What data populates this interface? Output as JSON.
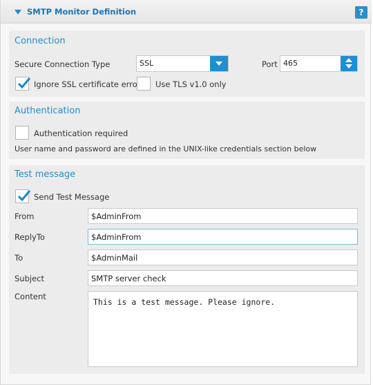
{
  "header": {
    "title": "SMTP Monitor Definition",
    "help_label": "?"
  },
  "connection": {
    "title": "Connection",
    "secure_type_label": "Secure Connection Type",
    "secure_type_value": "SSL",
    "port_label": "Port",
    "port_value": "465",
    "ignore_ssl_label": "Ignore SSL certificate errors",
    "ignore_ssl_checked": true,
    "tls_label": "Use TLS v1.0 only",
    "tls_checked": false
  },
  "authentication": {
    "title": "Authentication",
    "required_label": "Authentication required",
    "required_checked": false,
    "note": "User name and password are defined in the UNIX-like credentials section below"
  },
  "test_message": {
    "title": "Test message",
    "send_label": "Send Test Message",
    "send_checked": true,
    "from_label": "From",
    "from_value": "$AdminFrom",
    "replyto_label": "ReplyTo",
    "replyto_value": "$AdminFrom",
    "to_label": "To",
    "to_value": "$AdminMail",
    "subject_label": "Subject",
    "subject_value": "SMTP server check",
    "content_label": "Content",
    "content_value": "This is a test message. Please ignore."
  },
  "colors": {
    "accent": "#1e90c8",
    "button": "#1e8fd0",
    "check": "#1a86c4"
  }
}
